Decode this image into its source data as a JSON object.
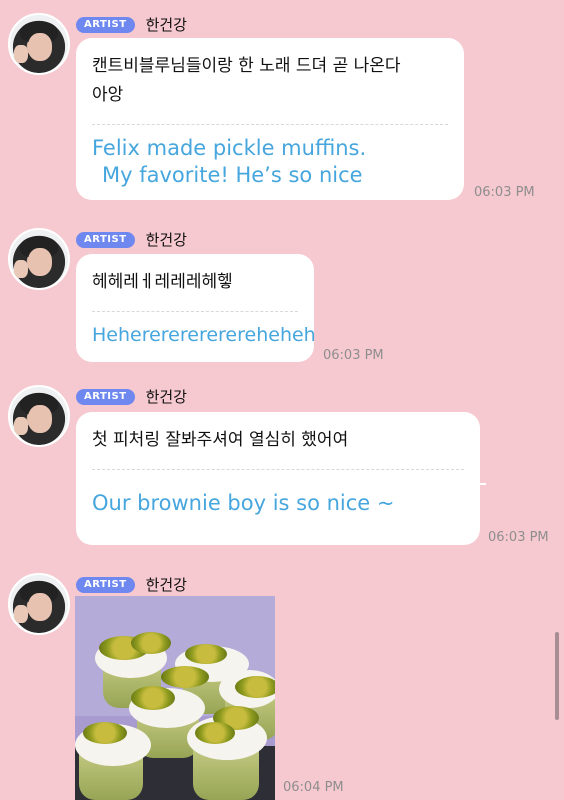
{
  "messages": [
    {
      "badge": "ARTIST",
      "name": "한건강",
      "korean_lines": [
        "캔트비블루님들이랑 한 노래 드뎌 곧 나온다",
        "아앙"
      ],
      "english_lines": [
        "Felix made pickle muffins.",
        "My favorite! He’s so nice"
      ],
      "time": "06:03 PM"
    },
    {
      "badge": "ARTIST",
      "name": "한건강",
      "korean_lines": [
        "헤헤레ㅔ레레레헤헿"
      ],
      "english_lines": [
        "Heherererererereheheh"
      ],
      "time": "06:03 PM"
    },
    {
      "badge": "ARTIST",
      "name": "한건강",
      "korean_lines": [
        "첫 피처링 잘봐주셔여 열심히 했어여"
      ],
      "english_lines": [
        "Our brownie boy is so nice ~"
      ],
      "time": "06:03 PM"
    },
    {
      "badge": "ARTIST",
      "name": "한건강",
      "image": "pickle-muffins-photo",
      "time": "06:04 PM"
    }
  ],
  "colors": {
    "background": "#f6c9d0",
    "badge": "#6f88f0",
    "translation_text": "#46a6dd",
    "timestamp": "#8e8e8e"
  }
}
